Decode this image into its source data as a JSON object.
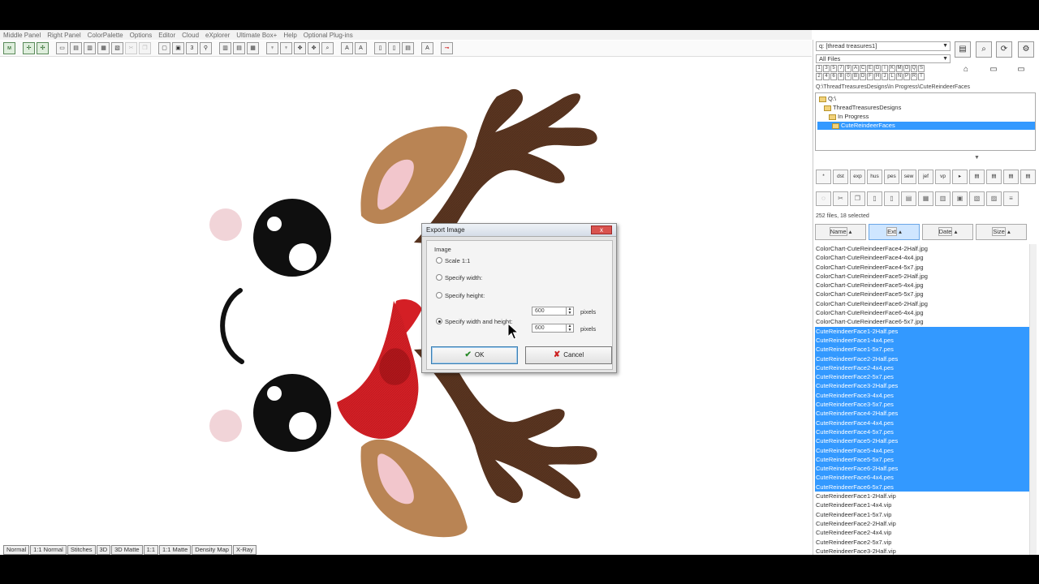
{
  "menu": [
    "Middle Panel",
    "Right Panel",
    "ColorPalette",
    "Options",
    "Editor",
    "Cloud",
    "eXplorer",
    "Ultimate Box+",
    "Help",
    "Optional Plug-ins"
  ],
  "bottom_tabs": [
    "Normal",
    "1:1 Normal",
    "Stitches",
    "3D",
    "3D Matte",
    "1:1",
    "1:1 Matte",
    "Density Map",
    "X-Ray"
  ],
  "right_panel": {
    "drive_combo": "q: [thread treasures1]",
    "filter_combo": "All Files",
    "letters_row1": [
      "1",
      "3",
      "5",
      "7",
      "9",
      "A",
      "C",
      "E",
      "G",
      "I",
      "K",
      "M",
      "O",
      "Q",
      "S"
    ],
    "letters_row2": [
      "2",
      "4",
      "6",
      "8",
      "0",
      "B",
      "D",
      "F",
      "H",
      "J",
      "L",
      "N",
      "P",
      "R",
      "T"
    ],
    "path": "Q:\\ThreadTreasuresDesigns\\In Progress\\CuteReindeerFaces",
    "tree": [
      "Q:\\",
      "ThreadTreasuresDesigns",
      "In Progress",
      "CuteReindeerFaces"
    ],
    "format_buttons": [
      "*",
      "dst",
      "exp",
      "hus",
      "pes",
      "sew",
      "jef",
      "vp"
    ],
    "file_count": "252 files, 18 selected",
    "sort_headers": [
      "Name",
      "Ext",
      "Date",
      "Size"
    ],
    "files": [
      {
        "name": "ColorChart-CuteReindeerFace4-2Half.jpg",
        "selected": false
      },
      {
        "name": "ColorChart-CuteReindeerFace4-4x4.jpg",
        "selected": false
      },
      {
        "name": "ColorChart-CuteReindeerFace4-5x7.jpg",
        "selected": false
      },
      {
        "name": "ColorChart-CuteReindeerFace5-2Half.jpg",
        "selected": false
      },
      {
        "name": "ColorChart-CuteReindeerFace5-4x4.jpg",
        "selected": false
      },
      {
        "name": "ColorChart-CuteReindeerFace5-5x7.jpg",
        "selected": false
      },
      {
        "name": "ColorChart-CuteReindeerFace6-2Half.jpg",
        "selected": false
      },
      {
        "name": "ColorChart-CuteReindeerFace6-4x4.jpg",
        "selected": false
      },
      {
        "name": "ColorChart-CuteReindeerFace6-5x7.jpg",
        "selected": false
      },
      {
        "name": "CuteReindeerFace1-2Half.pes",
        "selected": true
      },
      {
        "name": "CuteReindeerFace1-4x4.pes",
        "selected": true
      },
      {
        "name": "CuteReindeerFace1-5x7.pes",
        "selected": true
      },
      {
        "name": "CuteReindeerFace2-2Half.pes",
        "selected": true
      },
      {
        "name": "CuteReindeerFace2-4x4.pes",
        "selected": true
      },
      {
        "name": "CuteReindeerFace2-5x7.pes",
        "selected": true
      },
      {
        "name": "CuteReindeerFace3-2Half.pes",
        "selected": true
      },
      {
        "name": "CuteReindeerFace3-4x4.pes",
        "selected": true
      },
      {
        "name": "CuteReindeerFace3-5x7.pes",
        "selected": true
      },
      {
        "name": "CuteReindeerFace4-2Half.pes",
        "selected": true
      },
      {
        "name": "CuteReindeerFace4-4x4.pes",
        "selected": true
      },
      {
        "name": "CuteReindeerFace4-5x7.pes",
        "selected": true
      },
      {
        "name": "CuteReindeerFace5-2Half.pes",
        "selected": true
      },
      {
        "name": "CuteReindeerFace5-4x4.pes",
        "selected": true
      },
      {
        "name": "CuteReindeerFace5-5x7.pes",
        "selected": true
      },
      {
        "name": "CuteReindeerFace6-2Half.pes",
        "selected": true
      },
      {
        "name": "CuteReindeerFace6-4x4.pes",
        "selected": true
      },
      {
        "name": "CuteReindeerFace6-5x7.pes",
        "selected": true
      },
      {
        "name": "CuteReindeerFace1-2Half.vip",
        "selected": false
      },
      {
        "name": "CuteReindeerFace1-4x4.vip",
        "selected": false
      },
      {
        "name": "CuteReindeerFace1-5x7.vip",
        "selected": false
      },
      {
        "name": "CuteReindeerFace2-2Half.vip",
        "selected": false
      },
      {
        "name": "CuteReindeerFace2-4x4.vip",
        "selected": false
      },
      {
        "name": "CuteReindeerFace2-5x7.vip",
        "selected": false
      },
      {
        "name": "CuteReindeerFace3-2Half.vip",
        "selected": false
      }
    ]
  },
  "dialog": {
    "title": "Export Image",
    "close": "x",
    "group_label": "Image",
    "options": [
      "Scale 1:1",
      "Specify width:",
      "Specify height:",
      "Specify width and height:"
    ],
    "selected_option": "Specify width and height:",
    "width_value": "600",
    "height_value": "600",
    "unit": "pixels",
    "ok_label": "OK",
    "cancel_label": "Cancel"
  },
  "colors": {
    "selection": "#3399ff",
    "antler": "#5a3520",
    "ear": "#b98454",
    "ear_inner": "#f2c6cc",
    "eye": "#0f0f0f",
    "nose": "#d41f25",
    "cheek": "#f1d4d8"
  }
}
